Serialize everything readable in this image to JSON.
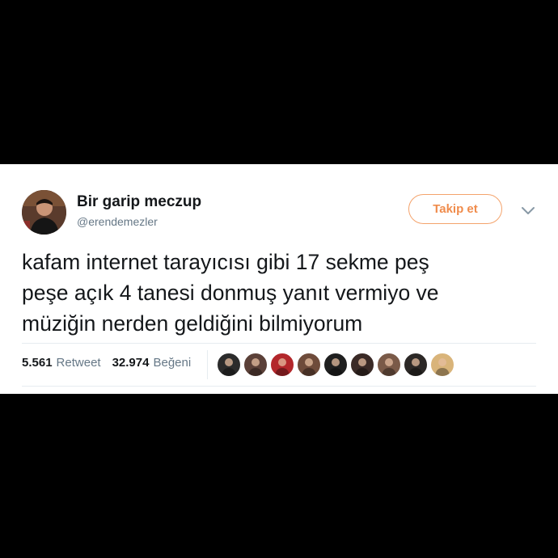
{
  "user": {
    "display_name": "Bir garip meczup",
    "handle": "@erendemezler"
  },
  "follow_button": {
    "label": "Takip et"
  },
  "more_menu": {
    "icon": "chevron-down-icon"
  },
  "tweet": {
    "line1": "kafam internet tarayıcısı gibi 17 sekme peş",
    "line2": "peşe açık 4 tanesi donmuş yanıt vermiyo ve",
    "line3": "müziğin nerden geldiğini bilmiyorum"
  },
  "stats": {
    "retweets": "5.561",
    "retweets_label": "Retweet",
    "likes": "32.974",
    "likes_label": "Beğeni"
  },
  "likers": [
    {
      "name": "liker-avatar-1",
      "color": "#2b2b2b"
    },
    {
      "name": "liker-avatar-2",
      "color": "#5b4038"
    },
    {
      "name": "liker-avatar-3",
      "color": "#b3272b"
    },
    {
      "name": "liker-avatar-4",
      "color": "#6e4b3a"
    },
    {
      "name": "liker-avatar-5",
      "color": "#1f1f1f"
    },
    {
      "name": "liker-avatar-6",
      "color": "#3a2a26"
    },
    {
      "name": "liker-avatar-7",
      "color": "#7a5a48"
    },
    {
      "name": "liker-avatar-8",
      "color": "#2c2826"
    },
    {
      "name": "liker-avatar-9",
      "color": "#d9b47a"
    }
  ],
  "colors": {
    "accent": "#f08c4c",
    "text": "#14171a",
    "muted": "#657786",
    "divider": "#e6ecf0"
  }
}
